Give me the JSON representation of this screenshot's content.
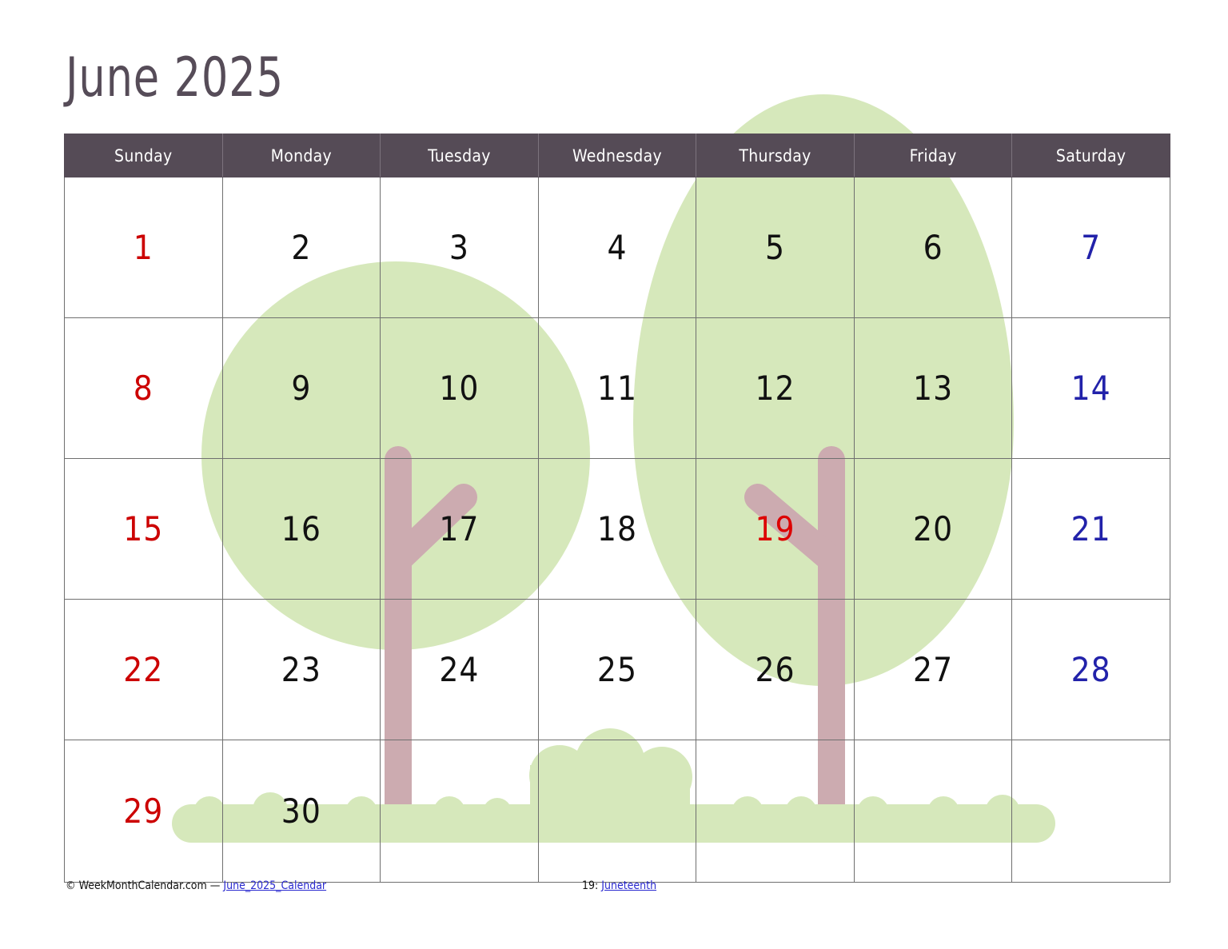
{
  "title": "June  2025",
  "colors": {
    "header_bg": "#554b56",
    "title_text": "#564c58",
    "sunday": "#cc0000",
    "saturday": "#2222aa",
    "holiday": "#dd0000",
    "weekday": "#111111",
    "foliage": "#d6e8bb",
    "trunk": "#ccabb0",
    "link": "#2a2ad0",
    "grid_line": "#6f6f6f"
  },
  "weekdays": [
    {
      "label": "Sunday"
    },
    {
      "label": "Monday"
    },
    {
      "label": "Tuesday"
    },
    {
      "label": "Wednesday"
    },
    {
      "label": "Thursday"
    },
    {
      "label": "Friday"
    },
    {
      "label": "Saturday"
    }
  ],
  "weeks": [
    [
      {
        "num": "1",
        "kind": "sun"
      },
      {
        "num": "2",
        "kind": "wd"
      },
      {
        "num": "3",
        "kind": "wd"
      },
      {
        "num": "4",
        "kind": "wd"
      },
      {
        "num": "5",
        "kind": "wd"
      },
      {
        "num": "6",
        "kind": "wd"
      },
      {
        "num": "7",
        "kind": "sat"
      }
    ],
    [
      {
        "num": "8",
        "kind": "sun"
      },
      {
        "num": "9",
        "kind": "wd"
      },
      {
        "num": "10",
        "kind": "wd"
      },
      {
        "num": "11",
        "kind": "wd"
      },
      {
        "num": "12",
        "kind": "wd"
      },
      {
        "num": "13",
        "kind": "wd"
      },
      {
        "num": "14",
        "kind": "sat"
      }
    ],
    [
      {
        "num": "15",
        "kind": "sun"
      },
      {
        "num": "16",
        "kind": "wd"
      },
      {
        "num": "17",
        "kind": "wd"
      },
      {
        "num": "18",
        "kind": "wd"
      },
      {
        "num": "19",
        "kind": "hol"
      },
      {
        "num": "20",
        "kind": "wd"
      },
      {
        "num": "21",
        "kind": "sat"
      }
    ],
    [
      {
        "num": "22",
        "kind": "sun"
      },
      {
        "num": "23",
        "kind": "wd"
      },
      {
        "num": "24",
        "kind": "wd"
      },
      {
        "num": "25",
        "kind": "wd"
      },
      {
        "num": "26",
        "kind": "wd"
      },
      {
        "num": "27",
        "kind": "wd"
      },
      {
        "num": "28",
        "kind": "sat"
      }
    ],
    [
      {
        "num": "29",
        "kind": "sun"
      },
      {
        "num": "30",
        "kind": "wd"
      },
      {
        "num": "",
        "kind": "empty"
      },
      {
        "num": "",
        "kind": "empty"
      },
      {
        "num": "",
        "kind": "empty"
      },
      {
        "num": "",
        "kind": "empty"
      },
      {
        "num": "",
        "kind": "empty"
      }
    ]
  ],
  "footer": {
    "copyright_symbol": "©",
    "site": "WeekMonthCalendar.com",
    "dash": "—",
    "calendar_link": "June_2025_Calendar",
    "holiday_prefix": "19:",
    "holiday_link": "Juneteenth"
  },
  "artwork": {
    "description": "two stylized trees with pale green foliage, dusty pink trunks, ground strip with bushes"
  }
}
